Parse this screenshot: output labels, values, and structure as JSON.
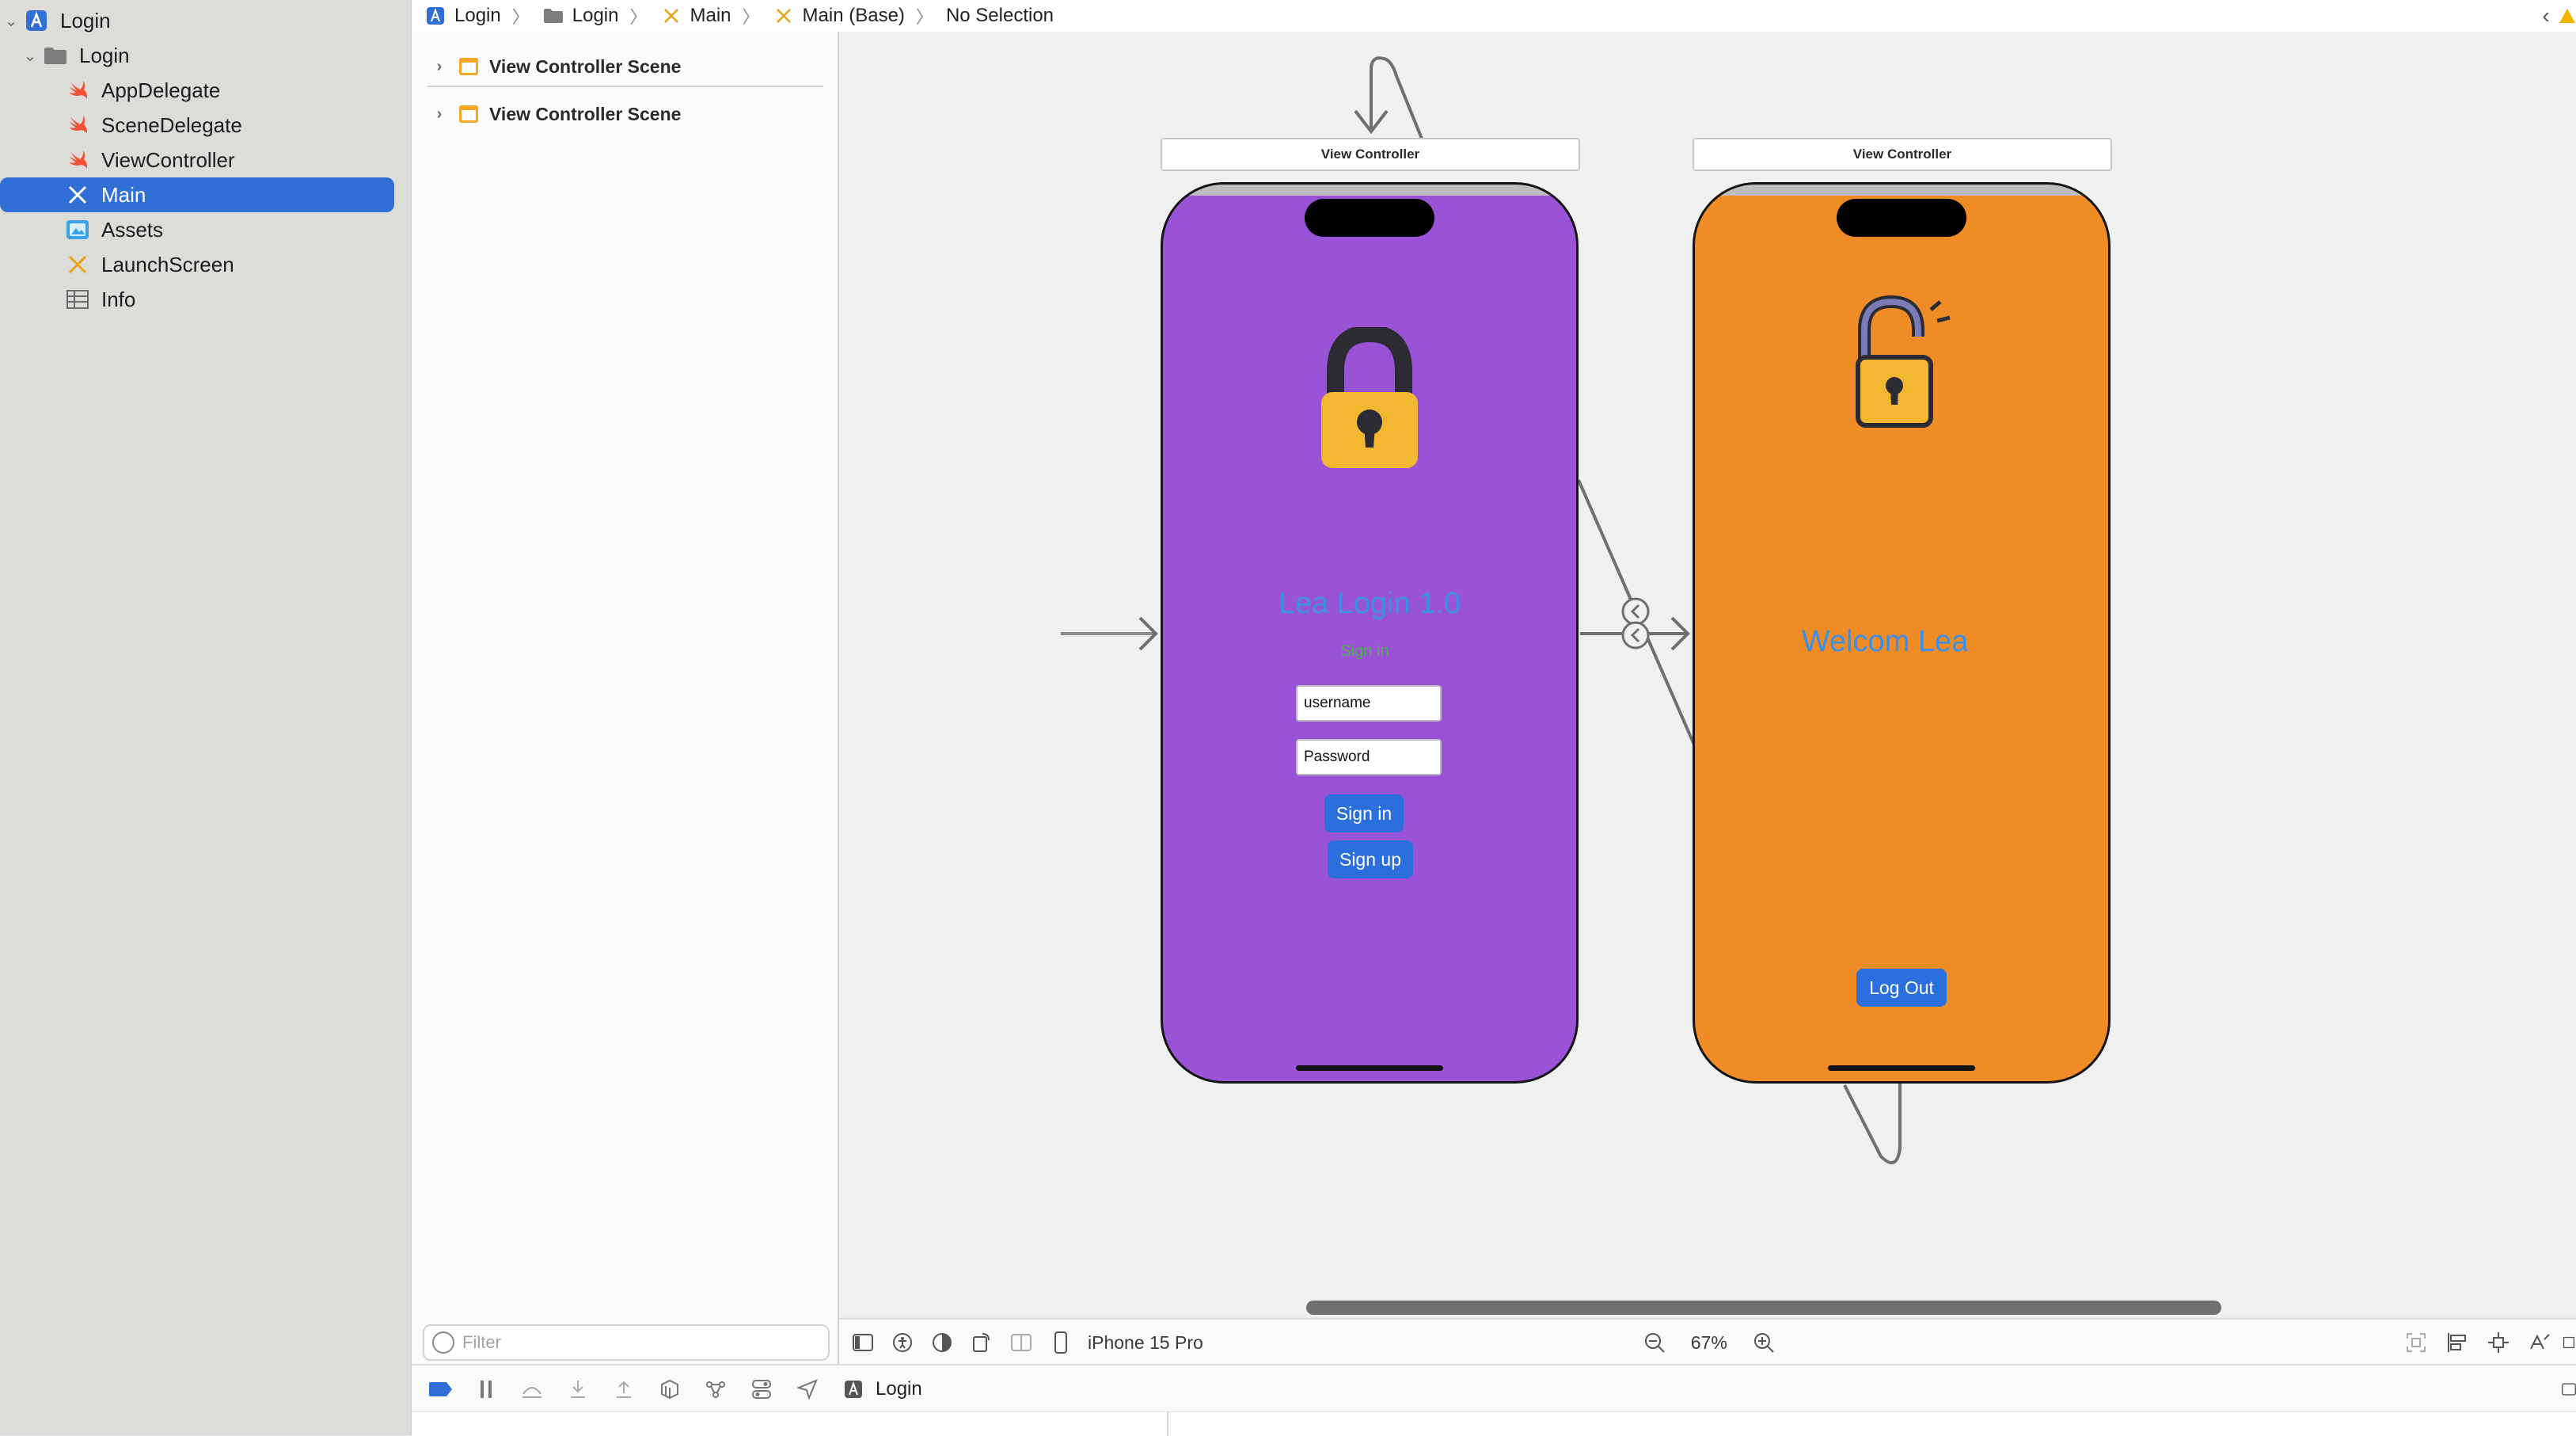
{
  "navigator": {
    "project": "Login",
    "group": "Login",
    "files": [
      {
        "label": "AppDelegate",
        "icon": "swift-icon"
      },
      {
        "label": "SceneDelegate",
        "icon": "swift-icon"
      },
      {
        "label": "ViewController",
        "icon": "swift-icon"
      },
      {
        "label": "Main",
        "icon": "storyboard-icon",
        "selected": true
      },
      {
        "label": "Assets",
        "icon": "asset-catalog-icon"
      },
      {
        "label": "LaunchScreen",
        "icon": "storyboard-icon"
      },
      {
        "label": "Info",
        "icon": "plist-icon"
      }
    ]
  },
  "breadcrumb": [
    "Login",
    "Login",
    "Main",
    "Main (Base)",
    "No Selection"
  ],
  "outline": {
    "scenes": [
      "View Controller Scene",
      "View Controller Scene"
    ],
    "filter_placeholder": "Filter"
  },
  "canvas": {
    "login_vc": {
      "title": "View Controller",
      "heading": "Lea Login 1.0",
      "subheading": "Sign in",
      "username_value": "username",
      "password_value": "Password",
      "signin_label": "Sign in",
      "signup_label": "Sign up",
      "background": "#9a52d6"
    },
    "welcome_vc": {
      "title": "View Controller",
      "heading": "Welcom Lea",
      "logout_label": "Log Out",
      "background": "#ef8c25"
    }
  },
  "canvas_bar": {
    "device": "iPhone 15 Pro",
    "zoom": "67%"
  },
  "debug_bar": {
    "scheme": "Login"
  },
  "colors": {
    "accent": "#2f6fd6",
    "button_blue": "#2a6fdc",
    "heading_blue": "#3b8fe8"
  }
}
